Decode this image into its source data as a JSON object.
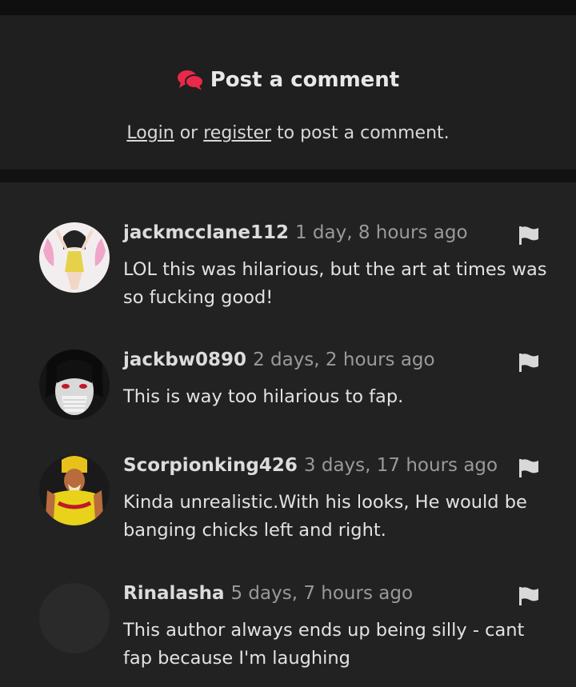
{
  "post_comment": {
    "title": "Post a comment",
    "login_link": "Login",
    "or_text": " or ",
    "register_link": "register",
    "suffix_text": " to post a comment."
  },
  "comments": [
    {
      "username": "jackmcclane112",
      "time": "1 day, 8 hours ago",
      "text": "LOL this was hilarious, but the art at times was so fucking good!"
    },
    {
      "username": "jackbw0890",
      "time": "2 days, 2 hours ago",
      "text": "This is way too hilarious to fap."
    },
    {
      "username": "Scorpionking426",
      "time": "3 days, 17 hours ago",
      "text": "Kinda unrealistic.With his looks, He would be banging chicks left and right."
    },
    {
      "username": "Rinalasha",
      "time": "5 days, 7 hours ago",
      "text": "This author always ends up being silly - cant fap because I'm laughing"
    }
  ],
  "icons": {
    "comments": "comments-icon",
    "flag": "flag-icon"
  },
  "colors": {
    "accent": "#e8294a",
    "background": "#222222",
    "text": "#e2e2e2",
    "muted": "#9a9a9a"
  }
}
